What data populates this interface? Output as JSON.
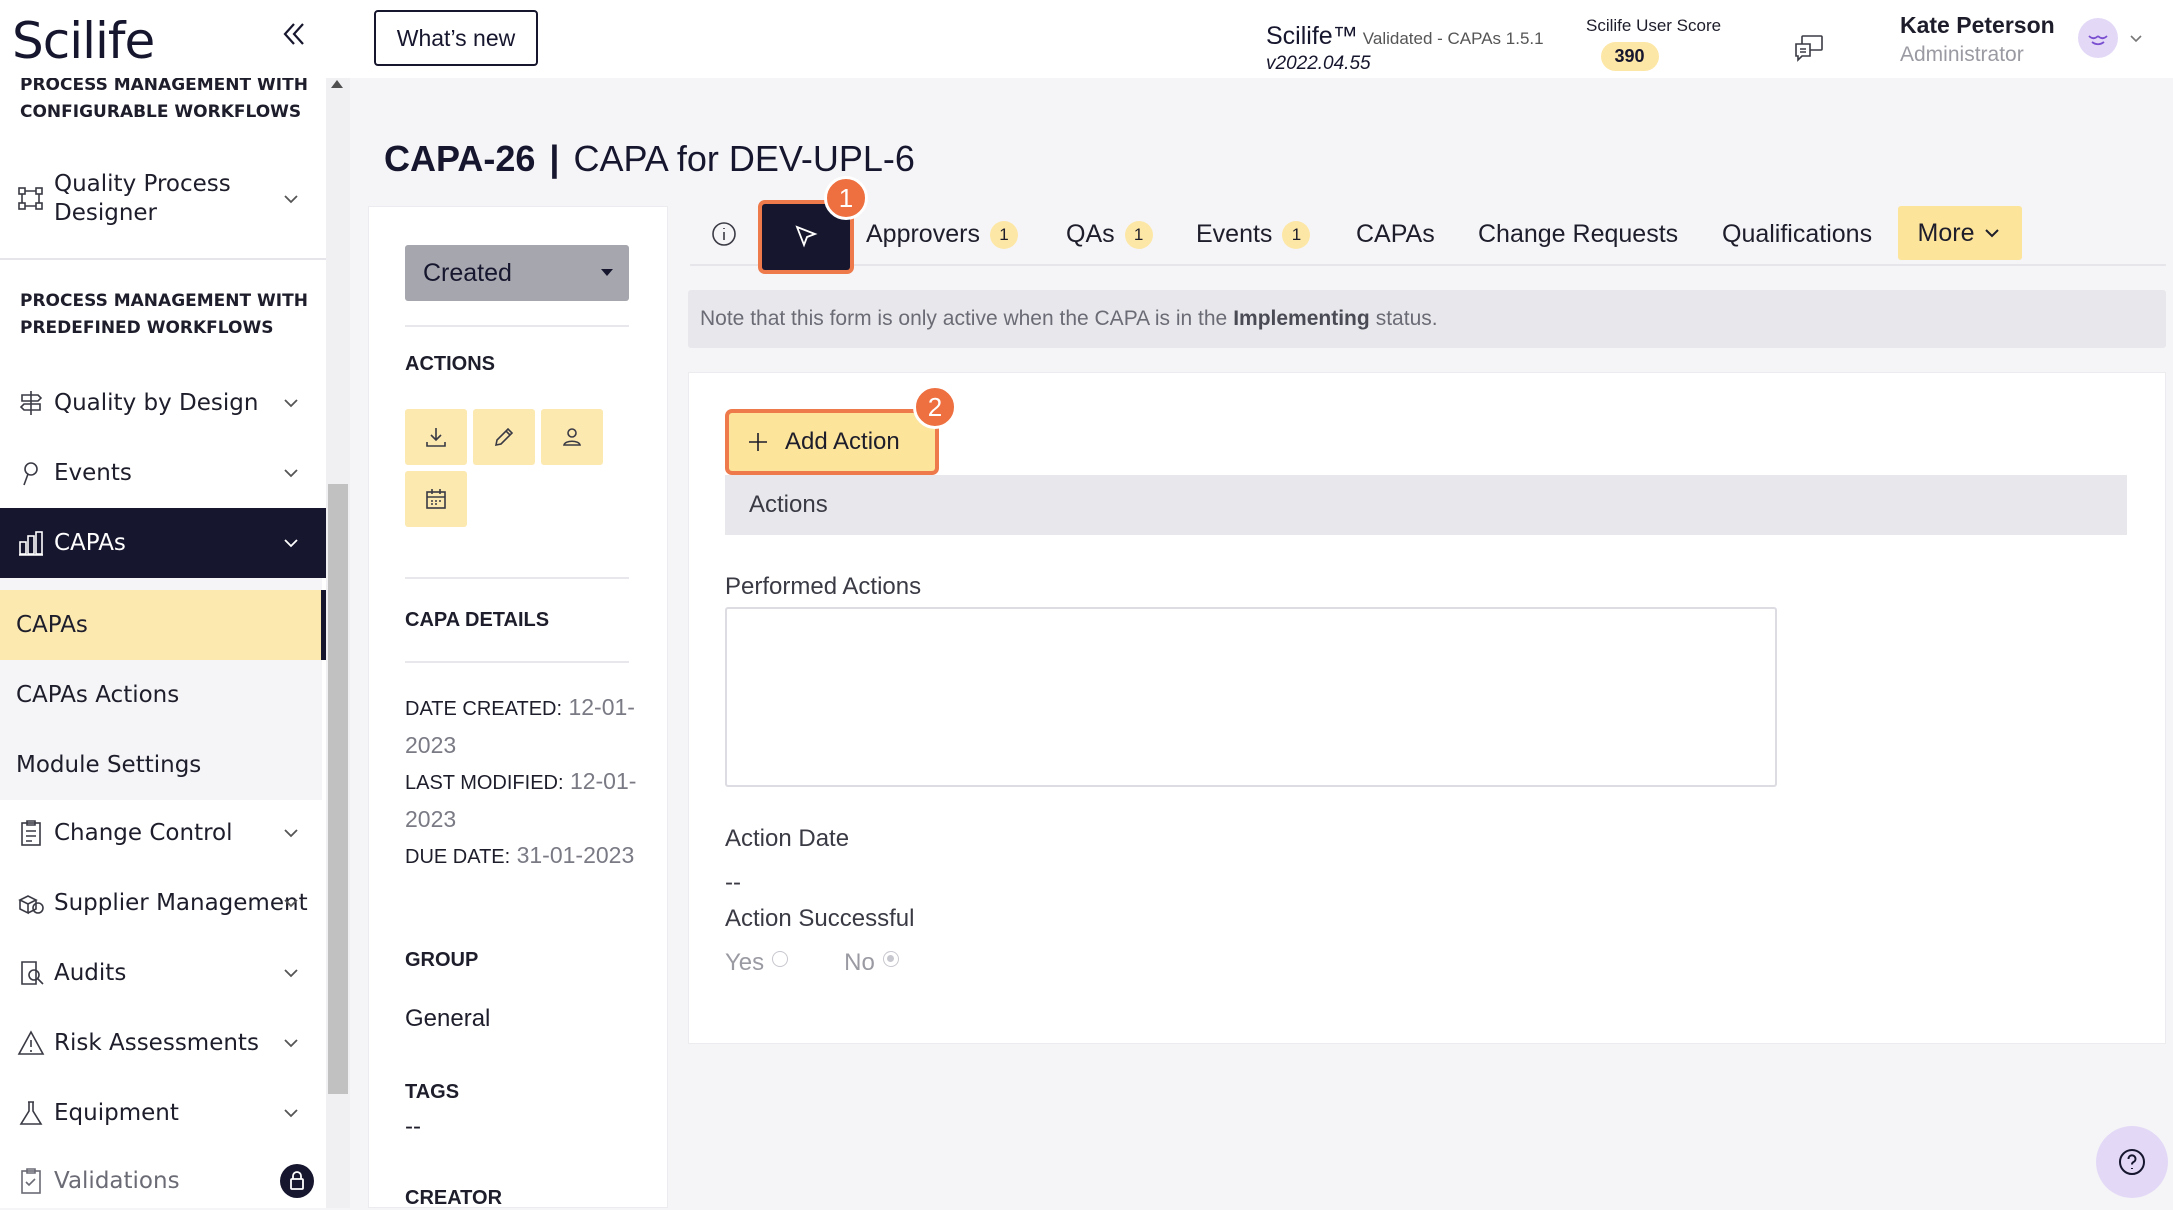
{
  "app": {
    "logo": "Scilife"
  },
  "sidebar": {
    "section_configurable": "PROCESS MANAGEMENT WITH CONFIGURABLE WORKFLOWS",
    "quality_process_designer": "Quality Process Designer",
    "section_predefined": "PROCESS MANAGEMENT WITH PREDEFINED WORKFLOWS",
    "items": [
      {
        "label": "Quality by Design",
        "icon": "signpost-icon"
      },
      {
        "label": "Events",
        "icon": "pin-icon"
      },
      {
        "label": "CAPAs",
        "icon": "capa-icon"
      },
      {
        "label": "Change Control",
        "icon": "clipboard-icon"
      },
      {
        "label": "Supplier Management",
        "icon": "boxes-icon"
      },
      {
        "label": "Audits",
        "icon": "audit-icon"
      },
      {
        "label": "Risk Assessments",
        "icon": "warning-icon"
      },
      {
        "label": "Equipment",
        "icon": "flask-icon"
      },
      {
        "label": "Validations",
        "icon": "checklist-icon"
      }
    ],
    "capa_subitems": [
      "CAPAs",
      "CAPAs Actions",
      "Module Settings"
    ],
    "selected_subitem": "CAPAs"
  },
  "topbar": {
    "whats_new": "What’s new",
    "app_name": "Scilife™",
    "validated": "Validated - CAPAs 1.5.1",
    "version": "v2022.04.55",
    "score_label": "Scilife User Score",
    "score_value": "390",
    "user_name": "Kate Peterson",
    "user_role": "Administrator"
  },
  "page": {
    "code": "CAPA-26",
    "separator": "|",
    "title": "CAPA for DEV-UPL-6"
  },
  "details": {
    "status": "Created",
    "actions_heading": "ACTIONS",
    "capa_details_heading": "CAPA DETAILS",
    "date_created_label": "DATE CREATED:",
    "date_created": "12-01-2023",
    "last_modified_label": "LAST MODIFIED:",
    "last_modified": "12-01-2023",
    "due_date_label": "DUE DATE:",
    "due_date": "31-01-2023",
    "group_heading": "GROUP",
    "group_value": "General",
    "tags_heading": "TAGS",
    "tags_value": "--",
    "creator_heading": "CREATOR"
  },
  "tabs": [
    {
      "label": "Approvers",
      "count": "1"
    },
    {
      "label": "QAs",
      "count": "1"
    },
    {
      "label": "Events",
      "count": "1"
    },
    {
      "label": "CAPAs"
    },
    {
      "label": "Change Requests"
    },
    {
      "label": "Qualifications"
    }
  ],
  "tab_more": "More",
  "step_markers": [
    "1",
    "2"
  ],
  "note": {
    "before": "Note that this form is only active when the CAPA is in the",
    "bold": "Implementing",
    "after": "status."
  },
  "form": {
    "add_action": "Add Action",
    "actions_bar": "Actions",
    "performed_actions_label": "Performed Actions",
    "performed_actions_value": "",
    "action_date_label": "Action Date",
    "action_date_value": "--",
    "action_successful_label": "Action Successful",
    "yes_label": "Yes",
    "no_label": "No",
    "selected": "No"
  },
  "colors": {
    "navy": "#16162e",
    "accent_yellow": "#fce9b0",
    "highlight_orange": "#ee6f3f",
    "help_purple": "#e3d9f7"
  }
}
